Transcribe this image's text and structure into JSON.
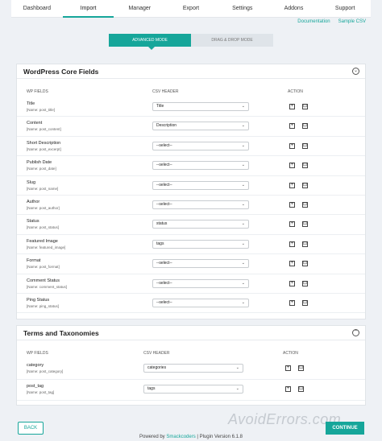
{
  "nav": [
    "Dashboard",
    "Import",
    "Manager",
    "Export",
    "Settings",
    "Addons",
    "Support"
  ],
  "links": {
    "documentation": "Documentation",
    "sample_csv": "Sample CSV"
  },
  "mode": {
    "advanced": "ADVANCED MODE",
    "drag_drop": "DRAG & DROP MODE"
  },
  "core": {
    "title": "WordPress Core Fields",
    "col_fields": "WP FIELDS",
    "col_csv": "CSV HEADER",
    "col_action": "ACTION",
    "rows": [
      {
        "label": "Title",
        "name": "[Name: post_title]",
        "value": "Title"
      },
      {
        "label": "Content",
        "name": "[Name: post_content]",
        "value": "Description"
      },
      {
        "label": "Short Description",
        "name": "[Name: post_excerpt]",
        "value": "--select--"
      },
      {
        "label": "Publish Date",
        "name": "[Name: post_date]",
        "value": "--select--"
      },
      {
        "label": "Slug",
        "name": "[Name: post_name]",
        "value": "--select--"
      },
      {
        "label": "Author",
        "name": "[Name: post_author]",
        "value": "--select--"
      },
      {
        "label": "Status",
        "name": "[Name: post_status]",
        "value": "status"
      },
      {
        "label": "Featured Image",
        "name": "[Name: featured_image]",
        "value": "tags"
      },
      {
        "label": "Format",
        "name": "[Name: post_format]",
        "value": "--select--"
      },
      {
        "label": "Comment Status",
        "name": "[Name: comment_status]",
        "value": "--select--"
      },
      {
        "label": "Ping Status",
        "name": "[Name: ping_status]",
        "value": "--select--"
      }
    ]
  },
  "terms": {
    "title": "Terms and Taxonomies",
    "col_fields": "WP FIELDS",
    "col_csv": "CSV HEADER",
    "col_action": "ACTION",
    "rows": [
      {
        "label": "category",
        "name": "[Name: post_category]",
        "value": "categories"
      },
      {
        "label": "post_tag",
        "name": "[Name: post_tag]",
        "value": "tags"
      }
    ]
  },
  "buttons": {
    "back": "BACK",
    "continue": "CONTINUE"
  },
  "footer": {
    "prefix": "Powered by ",
    "brand": "Smackcoders",
    "suffix": " | Plugin Version 6.1.8"
  },
  "watermark": "AvoidErrors.com"
}
